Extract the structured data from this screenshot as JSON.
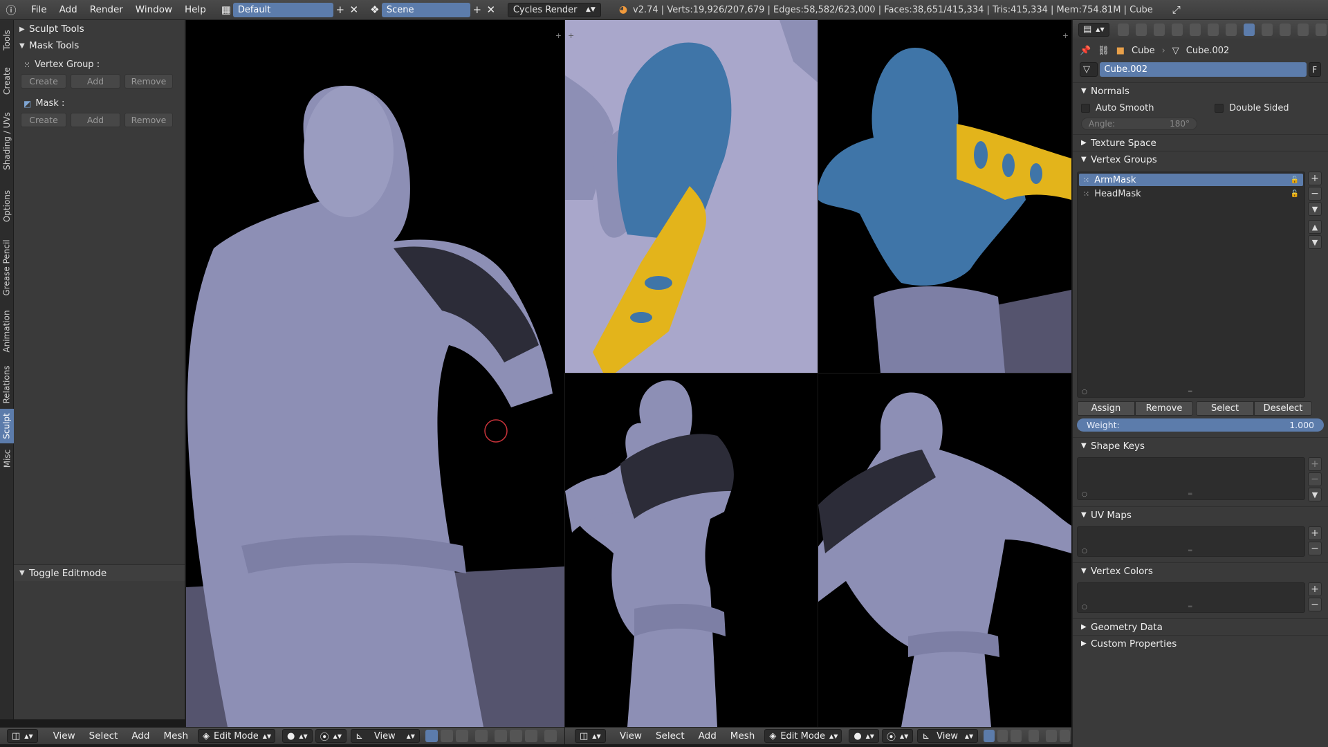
{
  "topbar": {
    "menus": [
      "File",
      "Add",
      "Render",
      "Window",
      "Help"
    ],
    "screen_layout": "Default",
    "scene": "Scene",
    "render_engine": "Cycles Render",
    "stats": "v2.74 | Verts:19,926/207,679 | Edges:58,582/623,000 | Faces:38,651/415,334 | Tris:415,334 | Mem:754.81M | Cube"
  },
  "tabs": [
    "Tools",
    "Create",
    "Shading / UVs",
    "Options",
    "Grease Pencil",
    "Animation",
    "Relations",
    "Sculpt",
    "Misc"
  ],
  "toolshelf": {
    "sculpt_tools": "Sculpt Tools",
    "mask_tools": "Mask Tools",
    "vertex_group_label": "Vertex Group :",
    "mask_label": "Mask :",
    "create": "Create",
    "add": "Add",
    "remove": "Remove",
    "toggle_editmode": "Toggle Editmode"
  },
  "viewport_header_left": {
    "menus": [
      "View",
      "Select",
      "Add",
      "Mesh"
    ],
    "mode": "Edit Mode",
    "orientation": "View"
  },
  "viewport_header_right": {
    "menus": [
      "View",
      "Select",
      "Add",
      "Mesh"
    ],
    "mode": "Edit Mode",
    "orientation": "View"
  },
  "properties": {
    "object": "Cube",
    "mesh": "Cube.002",
    "datablock": "Cube.002",
    "fake_user": "F",
    "normals": "Normals",
    "auto_smooth": "Auto Smooth",
    "double_sided": "Double Sided",
    "angle_label": "Angle:",
    "angle_value": "180°",
    "texture_space": "Texture Space",
    "vertex_groups": "Vertex Groups",
    "groups": [
      "ArmMask",
      "HeadMask"
    ],
    "assign": "Assign",
    "remove": "Remove",
    "select": "Select",
    "deselect": "Deselect",
    "weight_label": "Weight:",
    "weight_value": "1.000",
    "shape_keys": "Shape Keys",
    "uv_maps": "UV Maps",
    "vertex_colors": "Vertex Colors",
    "geometry_data": "Geometry Data",
    "custom_properties": "Custom Properties"
  },
  "colors": {
    "accent": "#5c7cab",
    "mesh": "#8d8fb5",
    "head_mask": "#3f75a8",
    "arm_mask": "#e3b41b"
  }
}
